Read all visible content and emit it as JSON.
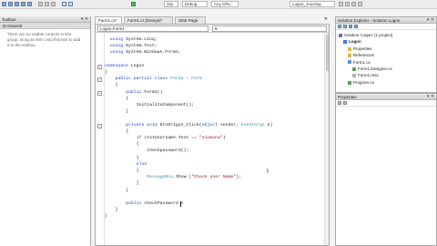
{
  "topbar": {
    "items": [
      "(Sp",
      "Debug",
      "Any CPU",
      "Logon_Jouvnay"
    ]
  },
  "toolbox": {
    "title": "Toolbox",
    "pin": "▾ ✕",
    "section": "General",
    "message": "There are no usable controls in this group. Drag an item onto this text to add it to the toolbox."
  },
  "tabs": [
    {
      "label": "Form1.cs*"
    },
    {
      "label": "Form1.cs [Design]*"
    },
    {
      "label": "Start Page"
    }
  ],
  "navbar": {
    "class_combo": "Logon.Form1",
    "member_combo": "▾"
  },
  "code_lines": [
    {
      "indent": 2,
      "parts": [
        {
          "t": "using",
          "c": "kw"
        },
        {
          "t": " System.Linq;"
        }
      ]
    },
    {
      "indent": 2,
      "parts": [
        {
          "t": "using",
          "c": "kw"
        },
        {
          "t": " System.Text;"
        }
      ]
    },
    {
      "indent": 2,
      "parts": [
        {
          "t": "using",
          "c": "kw"
        },
        {
          "t": " System.Windows.Forms;"
        }
      ]
    },
    {
      "indent": 0,
      "parts": []
    },
    {
      "indent": 0,
      "parts": [
        {
          "t": "namespace",
          "c": "kw"
        },
        {
          "t": " Logon"
        }
      ]
    },
    {
      "indent": 0,
      "parts": [
        {
          "t": "{"
        }
      ]
    },
    {
      "indent": 4,
      "parts": [
        {
          "t": "public partial class",
          "c": "kw"
        },
        {
          "t": " "
        },
        {
          "t": "Form1",
          "c": "typ"
        },
        {
          "t": " : "
        },
        {
          "t": "Form",
          "c": "typ"
        }
      ]
    },
    {
      "indent": 4,
      "parts": [
        {
          "t": "{"
        }
      ]
    },
    {
      "indent": 8,
      "parts": [
        {
          "t": "public",
          "c": "kw"
        },
        {
          "t": " Form1()"
        }
      ]
    },
    {
      "indent": 8,
      "parts": [
        {
          "t": "{"
        }
      ]
    },
    {
      "indent": 12,
      "parts": [
        {
          "t": "InitializeComponent();"
        }
      ]
    },
    {
      "indent": 8,
      "parts": [
        {
          "t": "}"
        }
      ]
    },
    {
      "indent": 0,
      "parts": []
    },
    {
      "indent": 8,
      "parts": [
        {
          "t": "private void",
          "c": "kw"
        },
        {
          "t": " btnOrigin_Click("
        },
        {
          "t": "object",
          "c": "kw"
        },
        {
          "t": " sender, "
        },
        {
          "t": "EventArgs",
          "c": "typ"
        },
        {
          "t": " e)"
        }
      ]
    },
    {
      "indent": 8,
      "parts": [
        {
          "t": "{"
        }
      ]
    },
    {
      "indent": 12,
      "parts": [
        {
          "t": "if",
          "c": "kw"
        },
        {
          "t": " (txtUsername.Text == "
        },
        {
          "t": "\"Vicmuna\"",
          "c": "str"
        },
        {
          "t": ")"
        }
      ]
    },
    {
      "indent": 12,
      "parts": [
        {
          "t": "{"
        }
      ]
    },
    {
      "indent": 16,
      "parts": [
        {
          "t": "checkpassword();"
        }
      ]
    },
    {
      "indent": 12,
      "parts": [
        {
          "t": "}"
        }
      ]
    },
    {
      "indent": 12,
      "parts": [
        {
          "t": "else",
          "c": "kw"
        }
      ]
    },
    {
      "indent": 12,
      "parts": [
        {
          "t": "{"
        }
      ]
    },
    {
      "indent": 16,
      "parts": [
        {
          "t": "MessageBox",
          "c": "typ"
        },
        {
          "t": ".Show ("
        },
        {
          "t": "\"Check user Name\"",
          "c": "str"
        },
        {
          "t": ");"
        }
      ]
    },
    {
      "indent": 12,
      "parts": [
        {
          "t": "}"
        }
      ]
    },
    {
      "indent": 8,
      "parts": [
        {
          "t": "}"
        }
      ]
    },
    {
      "indent": 0,
      "parts": []
    },
    {
      "indent": 8,
      "parts": [
        {
          "t": "public",
          "c": "kw"
        },
        {
          "t": " checkPassword "
        },
        {
          "t": "v",
          "c": "kw"
        }
      ]
    },
    {
      "indent": 4,
      "parts": [
        {
          "t": "}"
        }
      ]
    },
    {
      "indent": 0,
      "parts": [
        {
          "t": "}"
        }
      ]
    }
  ],
  "solution": {
    "title": "Solution Explorer - Solution Logon",
    "pin": "▾ ✕",
    "items": [
      {
        "label": "Solution 'Logon' (1 project)",
        "level": 0,
        "icon": "solution-icon"
      },
      {
        "label": "Logon",
        "level": 1,
        "icon": "project-icon",
        "bold": true
      },
      {
        "label": "Properties",
        "level": 2,
        "icon": "folder-icon"
      },
      {
        "label": "References",
        "level": 2,
        "icon": "folder-icon"
      },
      {
        "label": "Form1.cs",
        "level": 2,
        "icon": "form-icon"
      },
      {
        "label": "Form1.Designer.cs",
        "level": 3,
        "icon": "cs-file-icon"
      },
      {
        "label": "Form1.resx",
        "level": 3,
        "icon": "resx-file-icon"
      },
      {
        "label": "Program.cs",
        "level": 2,
        "icon": "cs-file-icon"
      }
    ]
  },
  "properties": {
    "title": "Properties",
    "pin": "▾ ✕"
  },
  "colors": {
    "keyword": "#1a3fcf",
    "string": "#a31515",
    "type": "#2b91af"
  }
}
